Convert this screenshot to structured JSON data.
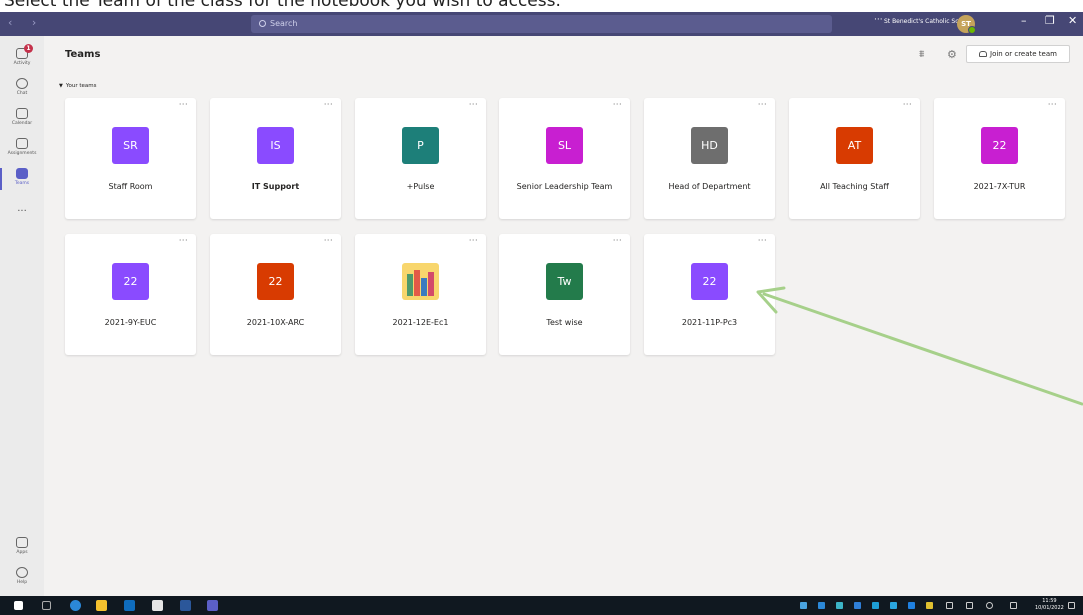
{
  "caption": "Select the Team of the class for the notebook you wish to access.",
  "titlebar": {
    "search_placeholder": "Search",
    "more": "···",
    "school": "St Benedict's Catholic School",
    "avatar_initials": "ST",
    "min": "–",
    "max": "❐",
    "close": "✕"
  },
  "rail": {
    "activity": "Activity",
    "activity_badge": "1",
    "chat": "Chat",
    "calendar": "Calendar",
    "assignments": "Assignments",
    "teams": "Teams",
    "more": "···",
    "apps": "Apps",
    "help": "Help"
  },
  "header": {
    "title": "Teams",
    "join_label": "Join or create team"
  },
  "section_label": "Your teams",
  "card_more": "···",
  "teams": [
    {
      "initials": "SR",
      "name": "Staff Room",
      "color": "#8a4bff"
    },
    {
      "initials": "IS",
      "name": "IT Support",
      "color": "#8a4bff"
    },
    {
      "initials": "P",
      "name": "+Pulse",
      "color": "#1d7f79"
    },
    {
      "initials": "SL",
      "name": "Senior Leadership Team",
      "color": "#c81fd1"
    },
    {
      "initials": "HD",
      "name": "Head of Department",
      "color": "#6e6e6e"
    },
    {
      "initials": "AT",
      "name": "All Teaching Staff",
      "color": "#d83b01"
    },
    {
      "initials": "22",
      "name": "2021-7X-TUR",
      "color": "#c81fd1"
    },
    {
      "initials": "22",
      "name": "2021-9Y-EUC",
      "color": "#8a4bff"
    },
    {
      "initials": "22",
      "name": "2021-10X-ARC",
      "color": "#d83b01"
    },
    {
      "initials": "",
      "name": "2021-12E-Ec1",
      "color": "#f8d66d",
      "image": "books-icon"
    },
    {
      "initials": "Tw",
      "name": "Test wise",
      "color": "#237b4b"
    },
    {
      "initials": "22",
      "name": "2021-11P-Pc3",
      "color": "#8a4bff"
    }
  ],
  "taskbar": {
    "time": "11:59",
    "date": "10/01/2022"
  },
  "colors": {
    "titlebar": "#464775",
    "accent": "#5b5fc7",
    "arrow": "#a6d08a"
  }
}
